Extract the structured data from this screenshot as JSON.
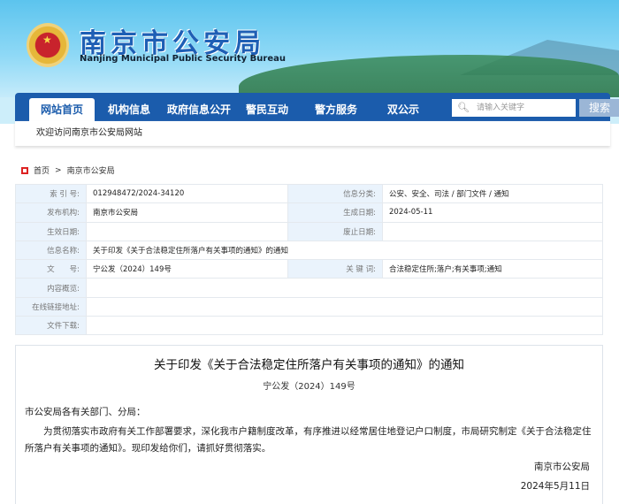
{
  "header": {
    "title_cn": "南京市公安局",
    "title_en": "Nanjing Municipal Public Security Bureau"
  },
  "nav": {
    "items": [
      "网站首页",
      "机构信息",
      "政府信息公开",
      "警民互动",
      "警方服务",
      "双公示"
    ],
    "search_placeholder": "请输入关键字",
    "search_button": "搜索"
  },
  "welcome": "欢迎访问南京市公安局网站",
  "breadcrumb": [
    "首页",
    "南京市公安局"
  ],
  "meta": {
    "index_label": "索 引 号:",
    "index": "012948472/2024-34120",
    "category_label": "信息分类:",
    "category": "公安、安全、司法 / 部门文件 / 通知",
    "publisher_label": "发布机构:",
    "publisher": "南京市公安局",
    "created_label": "生成日期:",
    "created": "2024-05-11",
    "effective_label": "生效日期:",
    "effective": "",
    "abolished_label": "废止日期:",
    "abolished": "",
    "name_label": "信息名称:",
    "name": "关于印发《关于合法稳定住所落户有关事项的通知》的通知",
    "docno_label": "文　　号:",
    "docno": "宁公发（2024）149号",
    "keywords_label": "关 键 词:",
    "keywords": "合法稳定住所;落户;有关事项;通知",
    "summary_label": "内容概览:",
    "link_label": "在线链接地址:",
    "download_label": "文件下载:"
  },
  "article": {
    "title": "关于印发《关于合法稳定住所落户有关事项的通知》的通知",
    "docno": "宁公发（2024）149号",
    "salutation": "市公安局各有关部门、分局：",
    "body": "为贯彻落实市政府有关工作部署要求，深化我市户籍制度改革，有序推进以经常居住地登记户口制度，市局研究制定《关于合法稳定住所落户有关事项的通知》。现印发给你们，请抓好贯彻落实。",
    "signature": "南京市公安局",
    "date": "2024年5月11日"
  }
}
